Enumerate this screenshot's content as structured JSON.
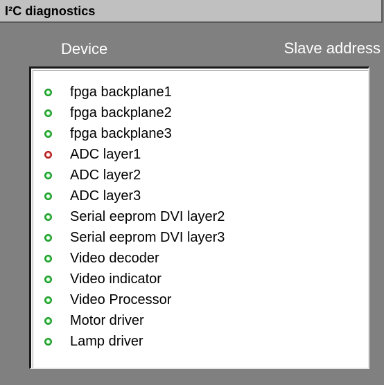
{
  "window": {
    "title": "I²C diagnostics"
  },
  "columns": {
    "device": "Device",
    "slave_address": "Slave address"
  },
  "devices": [
    {
      "name": "fpga backplane1",
      "status": "green"
    },
    {
      "name": "fpga backplane2",
      "status": "green"
    },
    {
      "name": "fpga backplane3",
      "status": "green"
    },
    {
      "name": "ADC layer1",
      "status": "red"
    },
    {
      "name": "ADC layer2",
      "status": "green"
    },
    {
      "name": "ADC layer3",
      "status": "green"
    },
    {
      "name": "Serial eeprom DVI layer2",
      "status": "green"
    },
    {
      "name": "Serial eeprom DVI layer3",
      "status": "green"
    },
    {
      "name": "Video decoder",
      "status": "green"
    },
    {
      "name": "Video indicator",
      "status": "green"
    },
    {
      "name": "Video Processor",
      "status": "green"
    },
    {
      "name": "Motor driver",
      "status": "green"
    },
    {
      "name": "Lamp driver",
      "status": "green"
    }
  ],
  "colors": {
    "background": "#808080",
    "titlebar": "#c0c0c0",
    "status_green": "#1f9a2b",
    "status_red": "#b01a1a"
  }
}
